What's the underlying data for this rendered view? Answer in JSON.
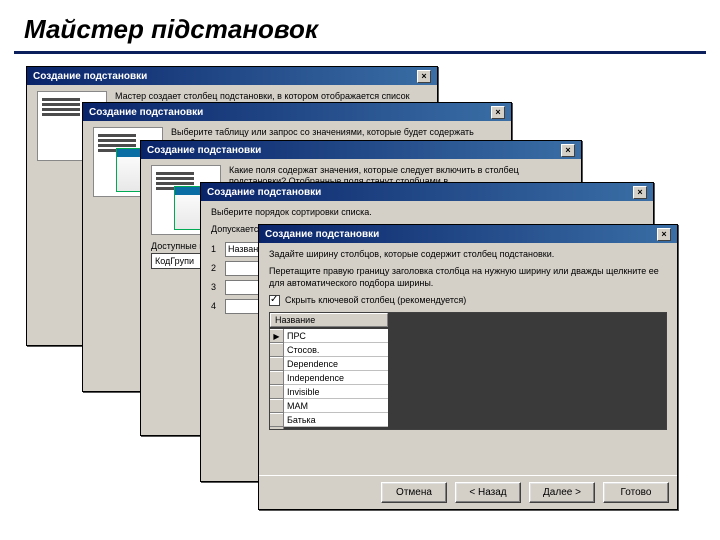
{
  "slide": {
    "title": "Майстер підстановок"
  },
  "d1": {
    "title": "Создание подстановки",
    "text": "Мастер создает столбец подстановки, в котором отображается список значений для выбора. Каким способом"
  },
  "d2": {
    "title": "Создание подстановки",
    "text": "Выберите таблицу или запрос со значениями, которые будет содержать столбец подстановки."
  },
  "d3": {
    "title": "Создание подстановки",
    "text": "Какие поля содержат значения, которые следует включить в столбец подстановки? Отобранные поля станут столбцами в",
    "available_label": "Доступные поля",
    "available_value": "КодГрупи"
  },
  "d4": {
    "title": "Создание подстановки",
    "text1": "Выберите порядок сортировки списка.",
    "text2": "Допускается сортировка записей по возрастанию или по убыванию, включающая до 4 полей.",
    "fields": {
      "f1": "Названи",
      "f2": "",
      "f3": "",
      "f4": ""
    }
  },
  "d5": {
    "title": "Создание подстановки",
    "text1": "Задайте ширину столбцов, которые содержит столбец подстановки.",
    "text2": "Перетащите правую границу заголовка столбца на нужную ширину или дважды щелкните ее для автоматического подбора ширины.",
    "checkbox": "Скрыть ключевой столбец (рекомендуется)",
    "colhead": "Название",
    "rows": [
      "ПРС",
      "Стосов.",
      "Dependence",
      "Independence",
      "Invisible",
      "МАМ",
      "Батька"
    ],
    "buttons": {
      "cancel": "Отмена",
      "back": "< Назад",
      "next": "Далее >",
      "finish": "Готово"
    }
  }
}
